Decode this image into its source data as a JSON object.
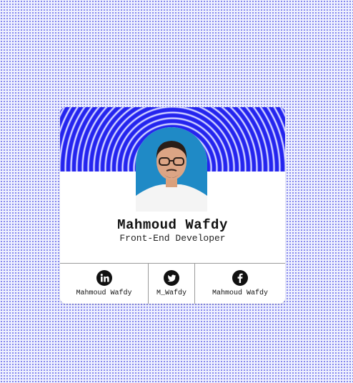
{
  "profile": {
    "name": "Mahmoud Wafdy",
    "role": "Front-End Developer"
  },
  "socials": [
    {
      "network": "linkedin",
      "icon": "linkedin-icon",
      "handle": "Mahmoud Wafdy"
    },
    {
      "network": "twitter",
      "icon": "twitter-icon",
      "handle": "M_Wafdy"
    },
    {
      "network": "facebook",
      "icon": "facebook-icon",
      "handle": "Mahmoud Wafdy"
    }
  ],
  "colors": {
    "accent": "#2424ee",
    "background": "#eef0ff",
    "dots": "#6c6ee8",
    "card": "#ffffff",
    "text": "#111111"
  }
}
